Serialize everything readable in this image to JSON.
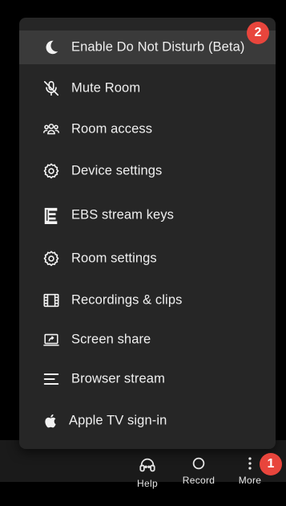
{
  "menu": {
    "items": [
      {
        "label": "Enable Do Not Disturb (Beta)",
        "icon": "moon-icon"
      },
      {
        "label": "Mute Room",
        "icon": "mic-off-icon"
      },
      {
        "label": "Room access",
        "icon": "users-icon"
      },
      {
        "label": "Device settings",
        "icon": "gear-icon"
      },
      {
        "label": "EBS stream keys",
        "icon": "ebs-logo-icon"
      },
      {
        "label": "Room settings",
        "icon": "gear-icon"
      },
      {
        "label": "Recordings & clips",
        "icon": "film-icon"
      },
      {
        "label": "Screen share",
        "icon": "screen-share-icon"
      },
      {
        "label": "Browser stream",
        "icon": "lines-icon"
      },
      {
        "label": "Apple TV sign-in",
        "icon": "apple-icon"
      }
    ]
  },
  "toolbar": {
    "help_label": "Help",
    "record_label": "Record",
    "more_label": "More"
  },
  "badges": {
    "more_badge": "1",
    "menu_badge": "2"
  },
  "colors": {
    "menu_bg": "#262626",
    "highlight_bg": "#3a3a3a",
    "badge": "#e8453c"
  }
}
